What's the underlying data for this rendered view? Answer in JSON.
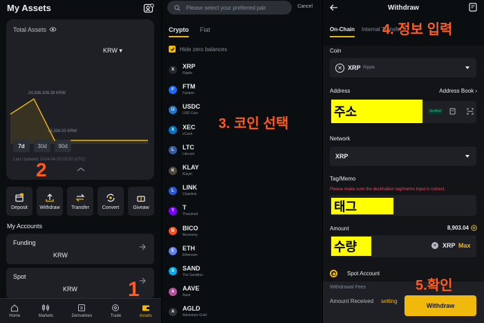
{
  "assets_screen": {
    "title": "My Assets",
    "total_assets_label": "Total Assets",
    "currency": "KRW",
    "chart_data": {
      "type": "line",
      "points": [
        [
          0,
          24936308.39
        ],
        [
          1,
          24936308.39
        ],
        [
          2,
          43336.03
        ],
        [
          3,
          43336.03
        ],
        [
          4,
          43336.03
        ]
      ],
      "max_label": "24,936,308.39 KRW",
      "min_label": "43,336.03 KRW",
      "ranges": [
        "7d",
        "30d",
        "90d"
      ],
      "active_range": "7d",
      "updated": "Last Updated: 2024-04-20 03:52 (UTC)"
    },
    "actions": [
      "Deposit",
      "Withdraw",
      "Transfer",
      "Convert",
      "Giveaw"
    ],
    "my_accounts_label": "My Accounts",
    "accounts": [
      {
        "name": "Funding",
        "value": "KRW"
      },
      {
        "name": "Spot",
        "value": "KRW"
      }
    ],
    "nav": [
      "Home",
      "Markets",
      "Derivatives",
      "Trade",
      "Assets"
    ]
  },
  "select_screen": {
    "search_placeholder": "Please select your preferred pair",
    "cancel": "Cancel",
    "tabs": [
      "Crypto",
      "Fiat"
    ],
    "hide_zero": "Hide zero balances",
    "coins": [
      {
        "sym": "XRP",
        "name": "Ripple",
        "color": "#23292f"
      },
      {
        "sym": "FTM",
        "name": "Fantom",
        "color": "#1969ff"
      },
      {
        "sym": "USDC",
        "name": "USD Coin",
        "color": "#2775ca"
      },
      {
        "sym": "XEC",
        "name": "eCash",
        "color": "#0074c2"
      },
      {
        "sym": "LTC",
        "name": "Litecoin",
        "color": "#345d9d"
      },
      {
        "sym": "KLAY",
        "name": "Klaytn",
        "color": "#4f473b"
      },
      {
        "sym": "LINK",
        "name": "Chainlink",
        "color": "#2a5ada"
      },
      {
        "sym": "T",
        "name": "Threshold",
        "color": "#7d00ff"
      },
      {
        "sym": "BICO",
        "name": "Biconomy",
        "color": "#ff4e17"
      },
      {
        "sym": "ETH",
        "name": "Ethereum",
        "color": "#627eea"
      },
      {
        "sym": "SAND",
        "name": "The Sandbox",
        "color": "#00adef"
      },
      {
        "sym": "AAVE",
        "name": "Aave",
        "color": "#b6509e"
      },
      {
        "sym": "AGLD",
        "name": "Adventure Gold",
        "color": "#333333"
      }
    ]
  },
  "withdraw_screen": {
    "title": "Withdraw",
    "tabs": [
      "On-Chain",
      "Internal Transfer"
    ],
    "coin_label": "Coin",
    "coin_value": "XRP",
    "coin_sub": "Ripple",
    "address_label": "Address",
    "address_book": "Address Book",
    "verified": "Verified",
    "network_label": "Network",
    "network_value": "XRP",
    "tag_label": "Tag/Memo",
    "tag_warning": "Please make sure the destination tag/memo input is correct.",
    "amount_label": "Amount",
    "amount_available": "8,903.04",
    "amount_unit": "XRP",
    "max": "Max",
    "spot_account": "Spot Account",
    "fees_label": "Withdrawal Fees",
    "received_label": "Amount Received",
    "setting": "setting",
    "withdraw_btn": "Withdraw"
  },
  "annotations": {
    "step1": "1",
    "step2": "2",
    "step3": "3. 코인 선택",
    "step4": "4. 정보 입력",
    "step5": "5.확인",
    "box_address": "주소",
    "box_tag": "태그",
    "box_amount": "수량"
  },
  "colors": {
    "accent": "#f0b90b",
    "annotation": "#ff5a1f",
    "highlight": "#ffff00"
  }
}
